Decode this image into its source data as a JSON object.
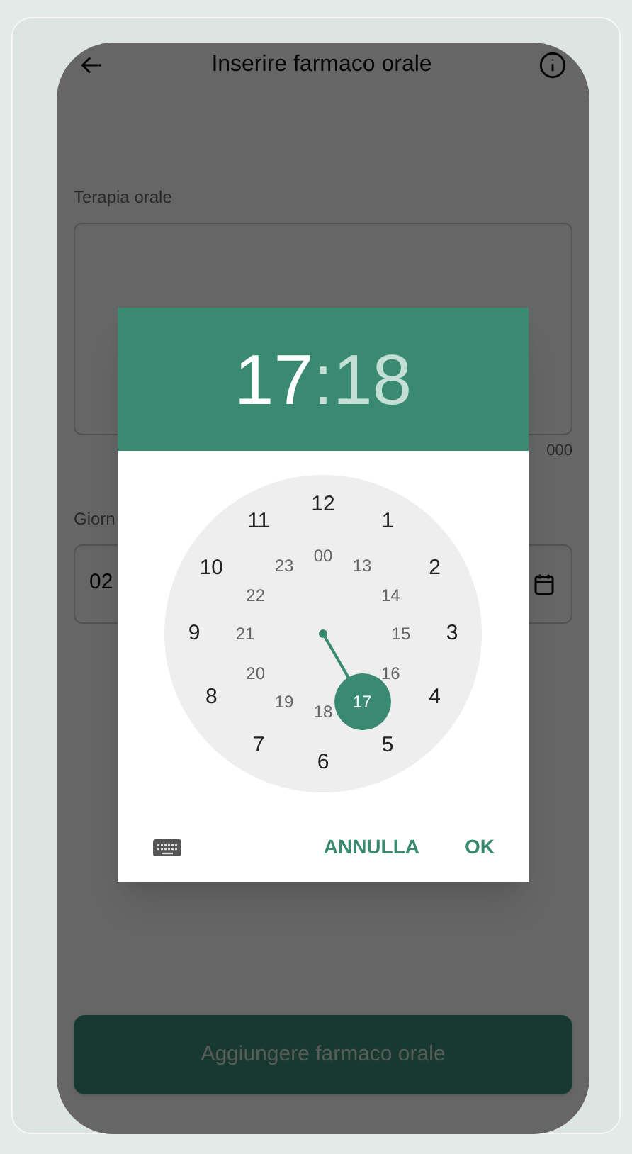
{
  "app_bar": {
    "title": "Inserire farmaco orale"
  },
  "therapy_field": {
    "label": "Terapia orale",
    "counter": "000"
  },
  "date_field": {
    "label": "Giorn",
    "value": "02"
  },
  "add_button": {
    "label": "Aggiungere farmaco orale",
    "disabled": true
  },
  "time_picker": {
    "hour": {
      "text": "17",
      "selected": true
    },
    "separator": ":",
    "minute": {
      "text": "18",
      "selected": false
    },
    "outer_ring": [
      {
        "label": "12",
        "selected": false
      },
      {
        "label": "1",
        "selected": false
      },
      {
        "label": "2",
        "selected": false
      },
      {
        "label": "3",
        "selected": false
      },
      {
        "label": "4",
        "selected": false
      },
      {
        "label": "5",
        "selected": false
      },
      {
        "label": "6",
        "selected": false
      },
      {
        "label": "7",
        "selected": false
      },
      {
        "label": "8",
        "selected": false
      },
      {
        "label": "9",
        "selected": false
      },
      {
        "label": "10",
        "selected": false
      },
      {
        "label": "11",
        "selected": false
      }
    ],
    "inner_ring": [
      {
        "label": "00",
        "selected": false
      },
      {
        "label": "13",
        "selected": false
      },
      {
        "label": "14",
        "selected": false
      },
      {
        "label": "15",
        "selected": false
      },
      {
        "label": "16",
        "selected": false
      },
      {
        "label": "17",
        "selected": true
      },
      {
        "label": "18",
        "selected": false
      },
      {
        "label": "19",
        "selected": false
      },
      {
        "label": "20",
        "selected": false
      },
      {
        "label": "21",
        "selected": false
      },
      {
        "label": "22",
        "selected": false
      },
      {
        "label": "23",
        "selected": false
      }
    ],
    "actions": [
      {
        "label": "ANNULLA"
      },
      {
        "label": "OK"
      }
    ]
  }
}
